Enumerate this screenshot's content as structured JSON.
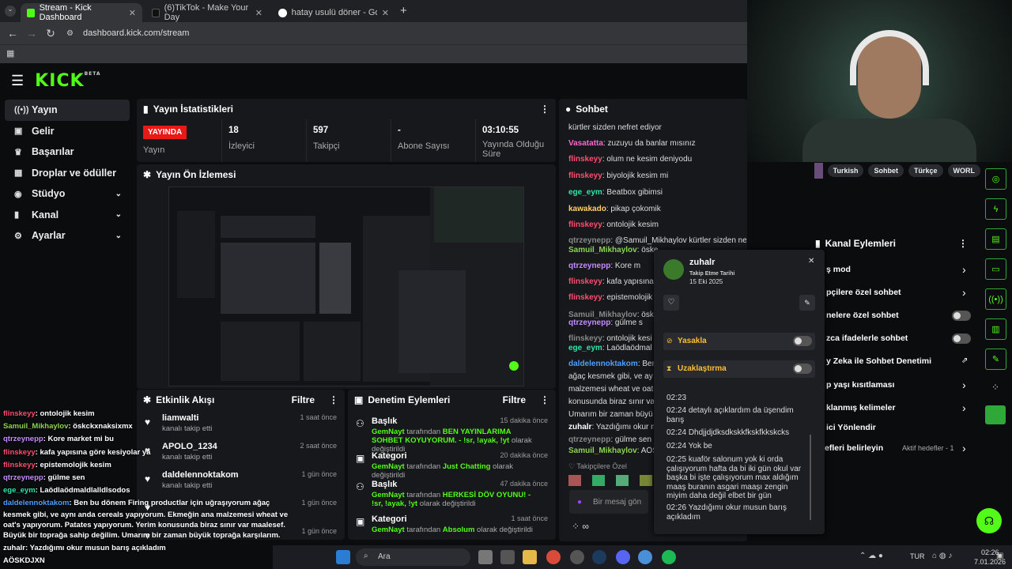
{
  "browser": {
    "tabs": [
      {
        "label": "Stream - Kick Dashboard",
        "active": true
      },
      {
        "label": "(6)TikTok - Make Your Day",
        "active": false
      },
      {
        "label": "hatay usulü döner - Google'da",
        "active": false
      }
    ],
    "url": "dashboard.kick.com/stream"
  },
  "header": {
    "logo": "KICK",
    "beta": "BETA"
  },
  "sidebar": {
    "items": [
      {
        "label": "Yayın",
        "icon": "broadcast-icon",
        "active": true,
        "chevron": false
      },
      {
        "label": "Gelir",
        "icon": "income-icon",
        "active": false,
        "chevron": false
      },
      {
        "label": "Başarılar",
        "icon": "trophy-icon",
        "active": false,
        "chevron": false
      },
      {
        "label": "Droplar ve ödüller",
        "icon": "gift-icon",
        "active": false,
        "chevron": false
      },
      {
        "label": "Stüdyo",
        "icon": "studio-icon",
        "active": false,
        "chevron": true
      },
      {
        "label": "Kanal",
        "icon": "channel-icon",
        "active": false,
        "chevron": true
      },
      {
        "label": "Ayarlar",
        "icon": "gear-icon",
        "active": false,
        "chevron": true
      }
    ]
  },
  "stats": {
    "title": "Yayın İstatistikleri",
    "live_badge": "YAYINDA",
    "live_label": "Yayın",
    "viewers_value": "18",
    "viewers_label": "İzleyici",
    "followers_value": "597",
    "followers_label": "Takipçi",
    "subs_value": "-",
    "subs_label": "Abone Sayısı",
    "uptime_value": "03:10:55",
    "uptime_label": "Yayında Olduğu Süre"
  },
  "preview": {
    "title": "Yayın Ön İzlemesi"
  },
  "activity": {
    "title": "Etkinlik Akışı",
    "filter": "Filtre",
    "items": [
      {
        "name": "liamwalti",
        "sub": "kanalı takip etti",
        "time": "1 saat önce"
      },
      {
        "name": "APOLO_1234",
        "sub": "kanalı takip etti",
        "time": "2 saat önce"
      },
      {
        "name": "daldelennoktakom",
        "sub": "kanalı takip etti",
        "time": "1 gün önce"
      },
      {
        "name": "",
        "sub": "",
        "time": "1 gün önce"
      },
      {
        "name": "",
        "sub": "",
        "time": "1 gün önce"
      }
    ]
  },
  "moderation": {
    "title": "Denetim Eylemleri",
    "filter": "Filtre",
    "items": [
      {
        "name": "Başlık",
        "actor": "GemNayt",
        "mid": " tarafından ",
        "value": "BEN YAYINLARIMA SOHBET KOYUYORUM. - !sr, !ayak, !yt",
        "end": " olarak değiştirildi",
        "time": "15 dakika önce"
      },
      {
        "name": "Kategori",
        "actor": "GemNayt",
        "mid": " tarafından ",
        "value": "Just Chatting",
        "end": " olarak değiştirildi",
        "time": "20 dakika önce"
      },
      {
        "name": "Başlık",
        "actor": "GemNayt",
        "mid": " tarafından ",
        "value": "HERKESİ DÖV OYUNU! - !sr, !ayak, !yt",
        "end": " olarak değiştirildi",
        "time": "47 dakika önce"
      },
      {
        "name": "Kategori",
        "actor": "GemNayt",
        "mid": " tarafından ",
        "value": "Absolum",
        "end": " olarak değiştirildi",
        "time": "1 saat önce"
      }
    ]
  },
  "chat": {
    "title": "Sohbet",
    "messages": [
      {
        "user": "",
        "text": "kürtler sizden nefret ediyor",
        "color": "#ffffff"
      },
      {
        "user": "Vasatatta",
        "text": ": zuzuyu da banlar mısınız",
        "color": "#ff66cc"
      },
      {
        "user": "flinskeyy",
        "text": ": olum ne kesim deniyodu",
        "color": "#ff4d6d"
      },
      {
        "user": "flinskeyy",
        "text": ": biyolojik kesim mi",
        "color": "#ff4d6d"
      },
      {
        "user": "ege_eym",
        "text": ": Beatbox gibimsi",
        "color": "#2ee6a8"
      },
      {
        "user": "kawakado",
        "text": ": pikap çokomik",
        "color": "#ffd166"
      },
      {
        "user": "flinskeyy",
        "text": ": ontolojik kesim",
        "color": "#ff4d6d"
      },
      {
        "user": "qtrzeynepp",
        "text": ": @Samuil_Mikhaylov kürtler sizden nefret ediyor kürtler si",
        "color": "#888888"
      },
      {
        "user": "Samuil_Mikhaylov",
        "text": ": öske",
        "color": "#8bd450"
      },
      {
        "user": "qtrzeynepp",
        "text": ": Kore m",
        "color": "#c58cff"
      },
      {
        "user": "flinskeyy",
        "text": ": kafa yapısına",
        "color": "#ff4d6d"
      },
      {
        "user": "flinskeyy",
        "text": ": epistemolojik",
        "color": "#ff4d6d"
      },
      {
        "user": "Samuil_Mikhaylov",
        "text": ": öske",
        "color": "#888888"
      },
      {
        "user": "qtrzeynepp",
        "text": ": gülme s",
        "color": "#c58cff"
      },
      {
        "user": "flinskeyy",
        "text": ": ontolojik kesi",
        "color": "#888888"
      },
      {
        "user": "ege_eym",
        "text": ": Laödlaödmal",
        "color": "#2ee6a8"
      },
      {
        "user": "daldelennoktakom",
        "text": ": Ben",
        "color": "#4d9fff"
      },
      {
        "user": "",
        "text": "ağaç kesmek gibi, ve ay",
        "color": "#ffffff"
      },
      {
        "user": "",
        "text": "malzemesi wheat ve oat",
        "color": "#ffffff"
      },
      {
        "user": "",
        "text": "konusunda biraz sınır va",
        "color": "#ffffff"
      },
      {
        "user": "",
        "text": "Umarım bir zaman büyü",
        "color": "#ffffff"
      },
      {
        "user": "zuhalr",
        "text": ": Yazdığımı okur m",
        "color": "#ffffff"
      },
      {
        "user": "qtrzeynepp",
        "text": ": gülme sen",
        "color": "#888888"
      },
      {
        "user": "Samuil_Mikhaylov",
        "text": ": AÖS",
        "color": "#8bd450"
      }
    ],
    "followers_only": "Takipçilere Özel",
    "input_placeholder": "Bir mesaj gön"
  },
  "usercard": {
    "username": "zuhalr",
    "follow_label": "Takip Etme Tarihi",
    "follow_date": "15 Eki 2025",
    "ban": "Yasakla",
    "timeout": "Uzaklaştırma",
    "messages": [
      {
        "time": "02:23",
        "text": ""
      },
      {
        "time": "02:24",
        "text": "detaylı açıklardım da üşendim barış"
      },
      {
        "time": "02:24",
        "text": "Dhdjjdjdksdkskkfkskfkkskcks"
      },
      {
        "time": "02:24",
        "text": "Yok be"
      },
      {
        "time": "02:25",
        "text": "kuaför salonum yok ki orda çalışıyorum hafta da bi iki gün okul var başka bi işte çalışıyorum max aldığım maaş buranın asgari maaşı zengin miyim daha değil elbet bir gün"
      },
      {
        "time": "02:26",
        "text": "Yazdığımı okur musun barış açıkladım"
      }
    ]
  },
  "right": {
    "tags": [
      "Turkish",
      "Sohbet",
      "Türkçe",
      "WORL"
    ],
    "actions_title": "Kanal Eylemleri",
    "actions": [
      {
        "label": "ş mod",
        "type": "chevron"
      },
      {
        "label": "pçilere özel sohbet",
        "type": "chevron"
      },
      {
        "label": "nelere özel sohbet",
        "type": "toggle"
      },
      {
        "label": "zca ifadelerle sohbet",
        "type": "toggle"
      },
      {
        "label": "y Zeka ile Sohbet Denetimi",
        "type": "external"
      },
      {
        "label": "p yaşı kısıtlaması",
        "type": "chevron"
      },
      {
        "label": "klanmış kelimeler",
        "type": "chevron"
      },
      {
        "label": "ici Yönlendir",
        "type": "none"
      },
      {
        "label": "efleri belirleyin",
        "type": "chevron"
      }
    ],
    "active_goals": "Aktif hedefler - 1"
  },
  "overlay": {
    "lines": [
      {
        "user": "flinskeyy",
        "text": ": ontolojik kesim",
        "color": "#ff4d6d"
      },
      {
        "user": "Samuil_Mikhaylov",
        "text": ": öskckxnaksixmx",
        "color": "#8bd450"
      },
      {
        "user": "qtrzeynepp",
        "text": ": Kore market mi bu",
        "color": "#c58cff"
      },
      {
        "user": "flinskeyy",
        "text": ": kafa yapısına göre kesiyolar ya",
        "color": "#ff4d6d"
      },
      {
        "user": "flinskeyy",
        "text": ": epistemolojik kesim",
        "color": "#ff4d6d"
      },
      {
        "user": "qtrzeynepp",
        "text": ": gülme sen",
        "color": "#c58cff"
      },
      {
        "user": "ege_eym",
        "text": ": Laödlaödmaldlalldlsodos",
        "color": "#2ee6a8"
      },
      {
        "user": "daldelennoktakom",
        "text": ": Ben bu dönem Firing productlar için uğraşıyorum ağaç",
        "color": "#4d9fff"
      },
      {
        "user": "",
        "text": "kesmek gibi, ve aynı anda cereals yapıyorum. Ekmeğin ana malzemesi wheat ve",
        "color": "#ffffff"
      },
      {
        "user": "",
        "text": "oat's yapıyorum. Patates yapıyorum. Yerim konusunda biraz sınır var maalesef.",
        "color": "#ffffff"
      },
      {
        "user": "",
        "text": "Büyük bir toprağa sahip değilim. Umarım bir zaman büyük toprağa karşılarım.",
        "color": "#ffffff"
      },
      {
        "user": "zuhalr",
        "text": ": Yazdığımı okur musun barış açıkladım",
        "color": "#ffffff"
      },
      {
        "user": "",
        "text": "AÖSKDJXN",
        "color": "#ffffff"
      }
    ]
  },
  "taskbar": {
    "search": "Ara",
    "lang": "TUR",
    "time": "02:26",
    "date": "7.01.2026"
  }
}
